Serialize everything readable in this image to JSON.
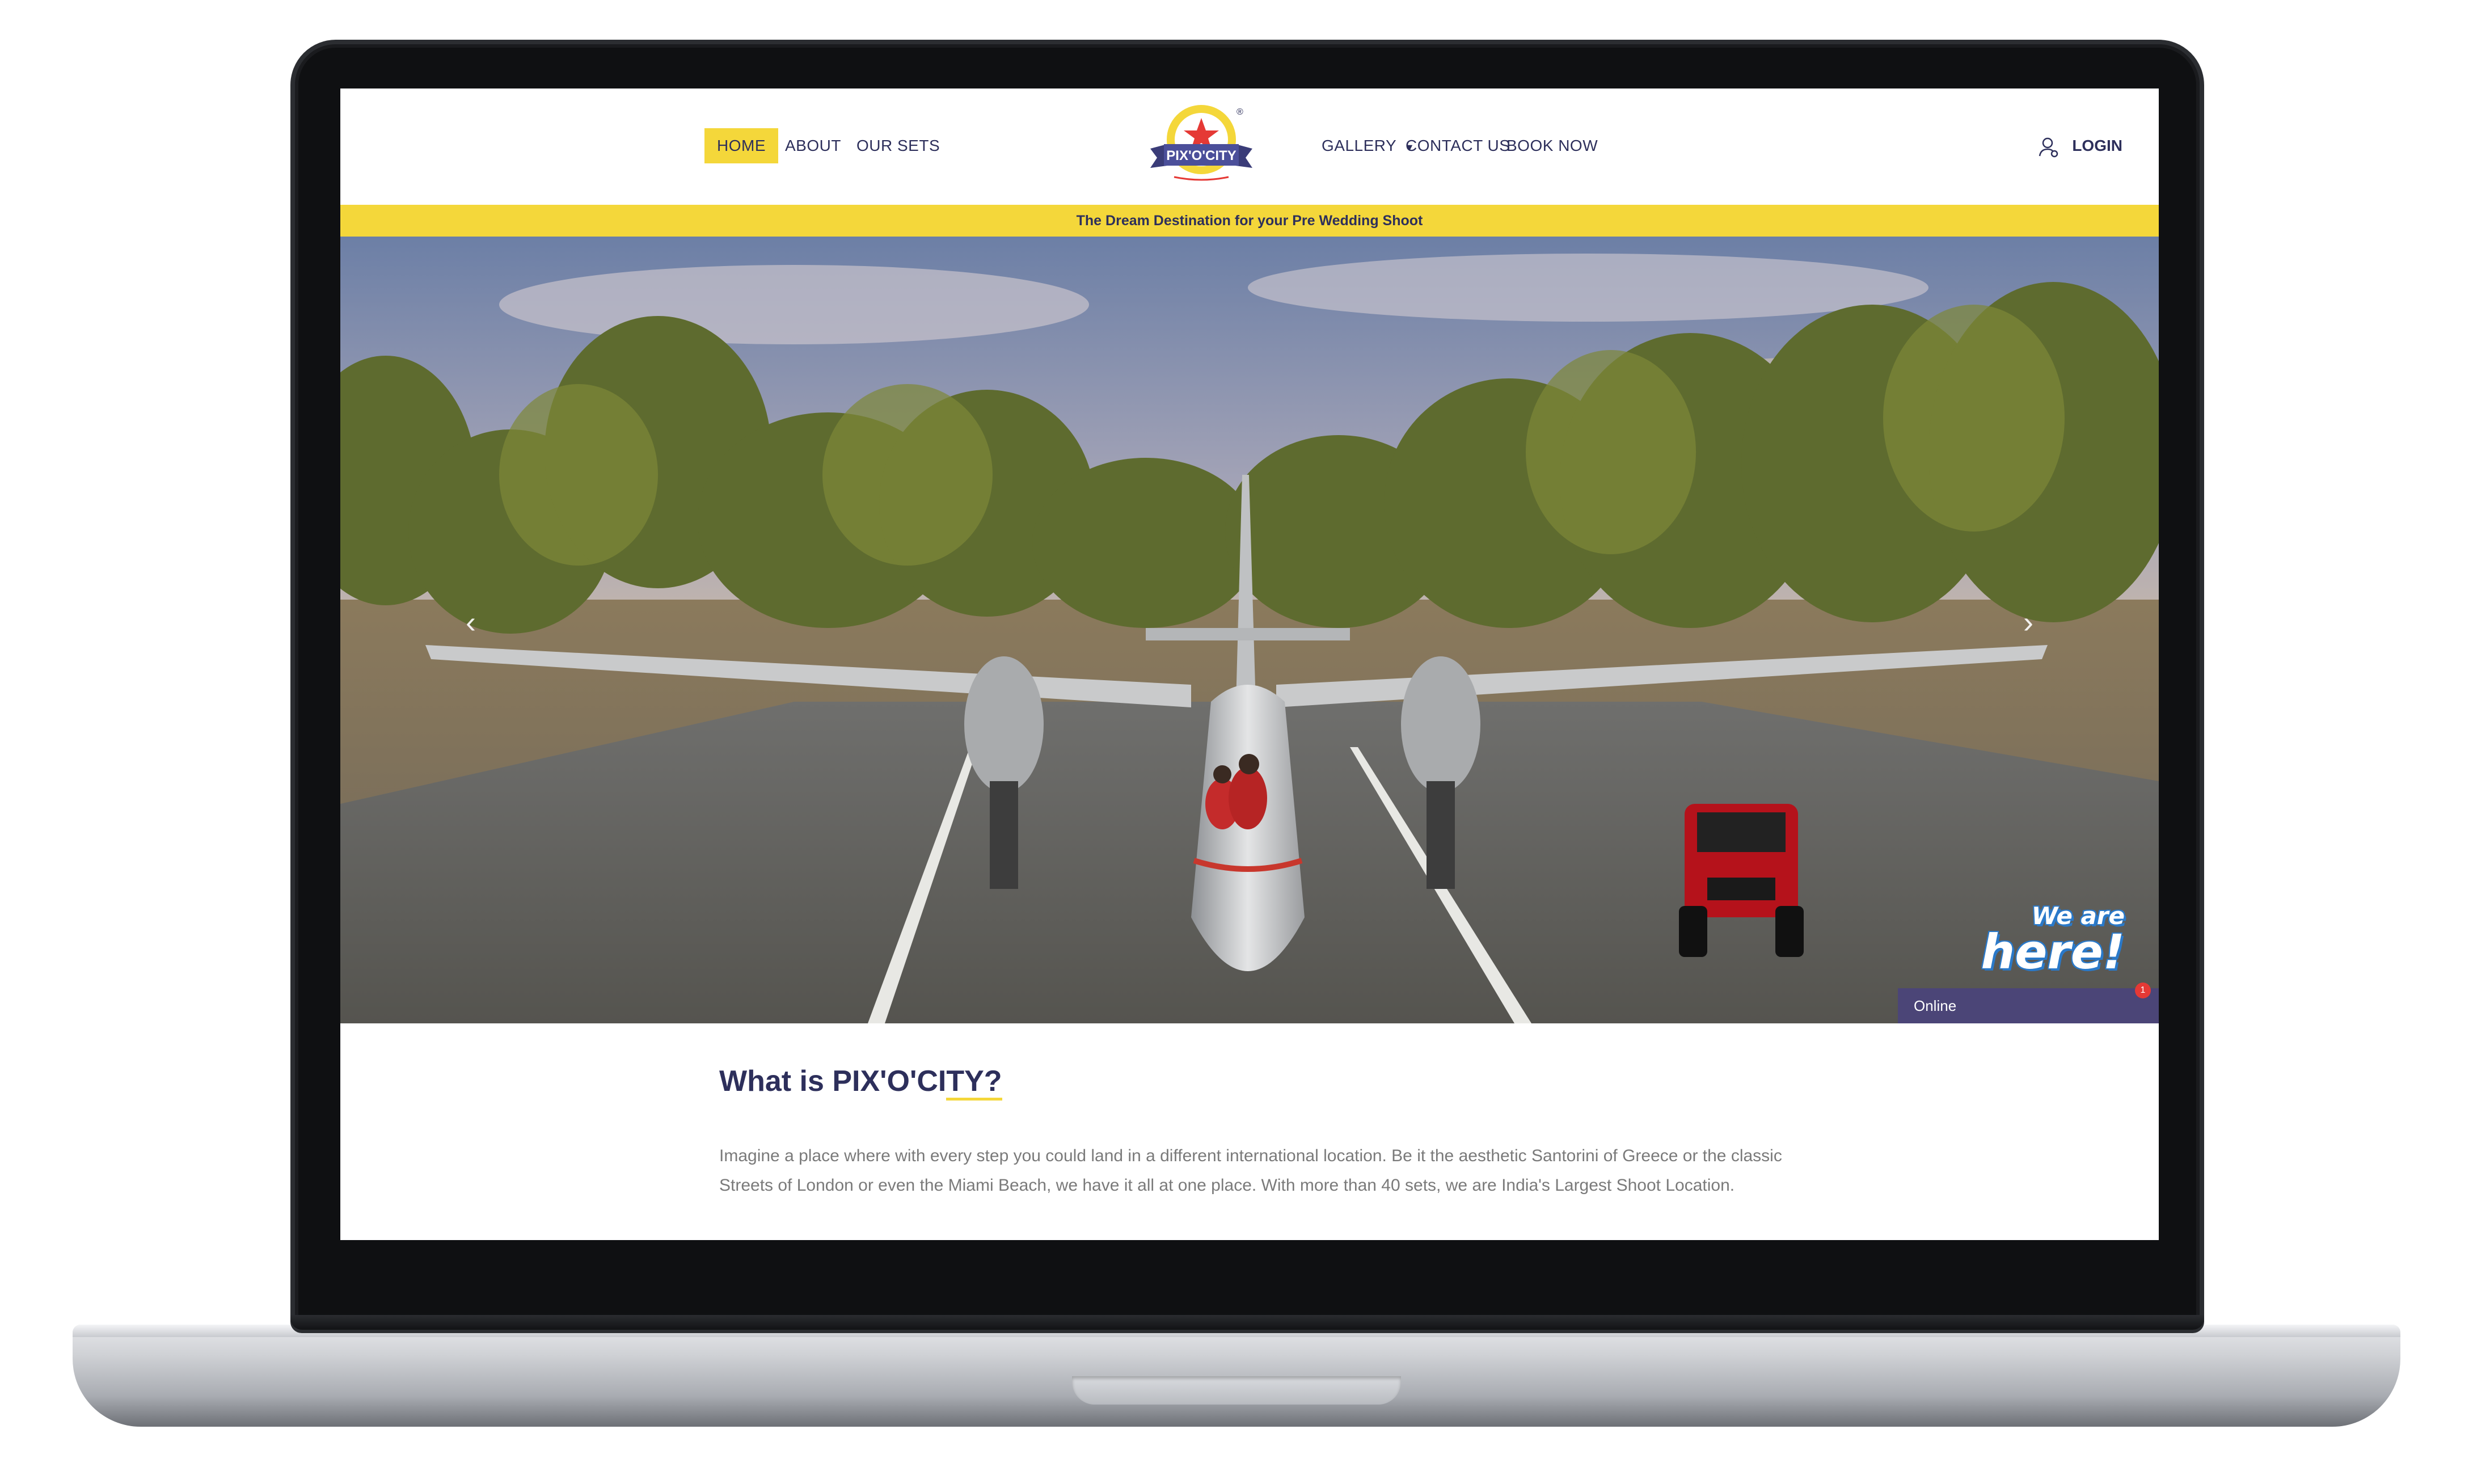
{
  "nav": {
    "home": "HOME",
    "about": "ABOUT",
    "our_sets": "OUR SETS",
    "gallery": "GALLERY",
    "contact_us": "CONTACT US",
    "book_now": "BOOK NOW",
    "login": "LOGIN"
  },
  "logo": {
    "name": "PIX'O'CITY",
    "registered": "®"
  },
  "ribbon": {
    "text": "The Dream Destination for your Pre Wedding Shoot"
  },
  "hero": {
    "prev_arrow": "‹",
    "next_arrow": "›"
  },
  "chat": {
    "title_line1": "We are",
    "title_line2": "here!",
    "status": "Online",
    "badge_count": "1"
  },
  "about": {
    "heading_prefix": "What is PIX'O'CI",
    "heading_highlight": "TY?",
    "body": "Imagine a place where with every step you could land in a different international location. Be it the aesthetic Santorini of Greece or the classic Streets of London or even the Miami Beach, we have it all at one place. With more than 40 sets, we are India's Largest Shoot Location."
  },
  "colors": {
    "accent": "#f4d73a",
    "navy": "#2d2f5b",
    "chat_bar": "#4b4577"
  }
}
